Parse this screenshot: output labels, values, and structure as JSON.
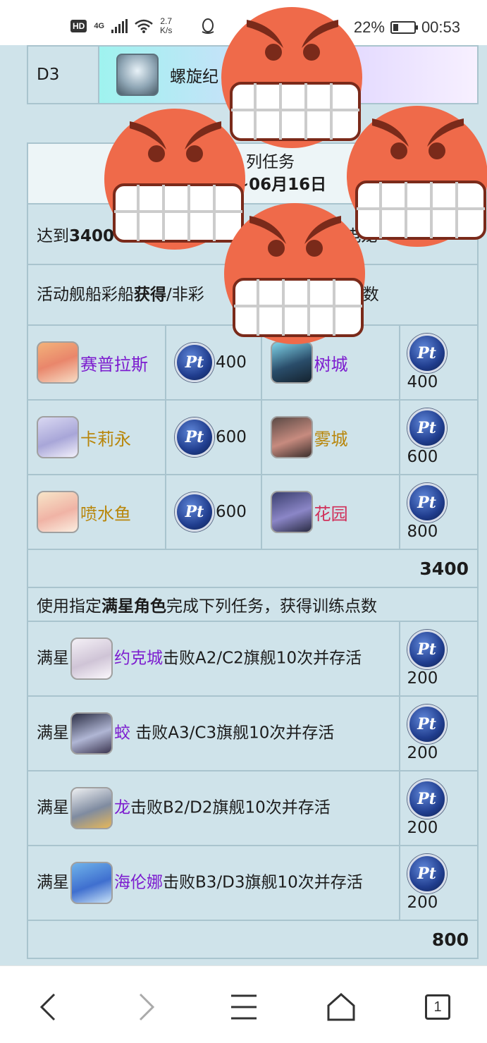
{
  "status_bar": {
    "network_badge": "HD",
    "network_type": "4G",
    "speed_value": "2.7",
    "speed_unit": "K/s",
    "battery_percent": "22%",
    "time": "00:53"
  },
  "ship_table": {
    "label": "D3",
    "value": "螺旋纪"
  },
  "mission_header": {
    "line1": "列任务",
    "line2": "~06月16日"
  },
  "reward_row": {
    "prefix": "达到",
    "bold_value": "3400",
    "suffix": "电龙"
  },
  "activity_desc": {
    "pre": "活动舰船彩船",
    "bold1": "获得",
    "mid": "/非彩",
    "post": "获得训练点数"
  },
  "ships": [
    {
      "left": {
        "name": "赛普拉斯",
        "color": "purple",
        "points": "400"
      },
      "right": {
        "name": "树城",
        "color": "purple",
        "points": "400"
      }
    },
    {
      "left": {
        "name": "卡莉永",
        "color": "gold",
        "points": "600"
      },
      "right": {
        "name": "雾城",
        "color": "gold",
        "points": "600"
      }
    },
    {
      "left": {
        "name": "喷水鱼",
        "color": "gold",
        "points": "600"
      },
      "right": {
        "name": "花园",
        "color": "red",
        "points": "800"
      }
    }
  ],
  "ships_total": "3400",
  "star_desc": {
    "pre": "使用指定",
    "bold": "满星角色",
    "post": "完成下列任务，获得训练点数"
  },
  "missions": [
    {
      "prefix": "满星",
      "name": "约克城",
      "task": "击败A2/C2旗舰10次并存活",
      "points": "200"
    },
    {
      "prefix": "满星",
      "name": "蛟",
      "task": " 击败A3/C3旗舰10次并存活",
      "points": "200"
    },
    {
      "prefix": "满星",
      "name": "龙",
      "task": "击败B2/D2旗舰10次并存活",
      "points": "200"
    },
    {
      "prefix": "满星",
      "name": "海伦娜",
      "task": "击败B3/D3旗舰10次并存活",
      "points": "200"
    }
  ],
  "missions_total": "800",
  "pt_label": "Pt",
  "nav": {
    "back_icon": "chevron-left-icon",
    "forward_icon": "chevron-right-icon",
    "menu_icon": "menu-icon",
    "home_icon": "home-icon",
    "tab_count": "1"
  },
  "colors": {
    "purple": "#7c1ccf",
    "gold": "#b8860b",
    "red": "#d0305a",
    "page_bg": "#cfe3ea",
    "face_orange": "#ef6a4a"
  }
}
